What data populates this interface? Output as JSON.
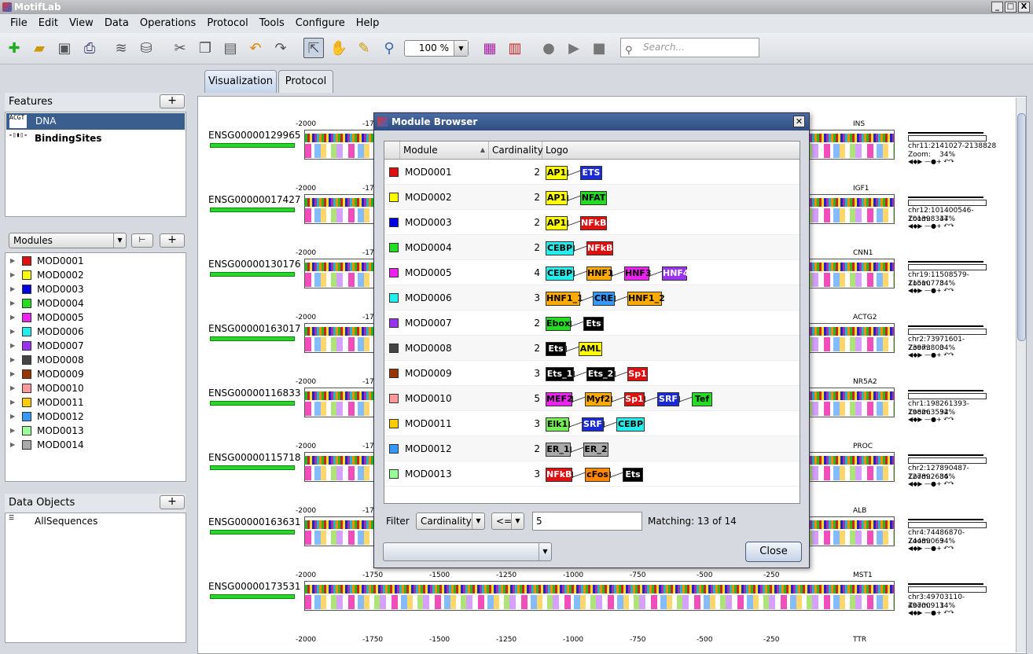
{
  "app": {
    "title": "MotifLab",
    "win_buttons": [
      "_",
      "□",
      "X"
    ]
  },
  "menu": [
    "File",
    "Edit",
    "View",
    "Data",
    "Operations",
    "Protocol",
    "Tools",
    "Configure",
    "Help"
  ],
  "toolbar": {
    "zoom": "100 %",
    "search_placeholder": "Search..."
  },
  "features": {
    "title": "Features",
    "add": "+",
    "items": [
      {
        "label": "DNA",
        "icon": "ACGT"
      },
      {
        "label": "BindingSites"
      }
    ]
  },
  "modules_panel": {
    "combo": "Modules",
    "add": "+",
    "items": [
      {
        "name": "MOD0001",
        "color": "#e01010"
      },
      {
        "name": "MOD0002",
        "color": "#ffff00"
      },
      {
        "name": "MOD0003",
        "color": "#0000e0"
      },
      {
        "name": "MOD0004",
        "color": "#22dd22"
      },
      {
        "name": "MOD0005",
        "color": "#ee22ee"
      },
      {
        "name": "MOD0006",
        "color": "#22eeee"
      },
      {
        "name": "MOD0007",
        "color": "#9933ee"
      },
      {
        "name": "MOD0008",
        "color": "#444444"
      },
      {
        "name": "MOD0009",
        "color": "#993300"
      },
      {
        "name": "MOD0010",
        "color": "#ff9999"
      },
      {
        "name": "MOD0011",
        "color": "#ffcc00"
      },
      {
        "name": "MOD0012",
        "color": "#3399ff"
      },
      {
        "name": "MOD0013",
        "color": "#99ff99"
      },
      {
        "name": "MOD0014",
        "color": "#aaaaaa"
      }
    ]
  },
  "data_objects": {
    "title": "Data Objects",
    "add": "+",
    "items": [
      "AllSequences"
    ]
  },
  "tabs": [
    "Visualization",
    "Protocol"
  ],
  "sequences": [
    {
      "name": "ENSG00000129965",
      "gene": "INS",
      "coord": "chr11:2141027-2138828",
      "zoom": "34%",
      "dir": "left"
    },
    {
      "name": "ENSG00000017427",
      "gene": "IGF1",
      "coord": "chr12:101400546-101398347",
      "zoom": "34%",
      "dir": "left"
    },
    {
      "name": "ENSG00000130176",
      "gene": "CNN1",
      "coord": "chr19:11508579-11510778",
      "zoom": "34%",
      "dir": "right"
    },
    {
      "name": "ENSG00000163017",
      "gene": "ACTG2",
      "coord": "chr2:73971601-73973800",
      "zoom": "34%",
      "dir": "right"
    },
    {
      "name": "ENSG00000116833",
      "gene": "NR5A2",
      "coord": "chr1:198261393-198263592",
      "zoom": "34%",
      "dir": "right"
    },
    {
      "name": "ENSG00000115718",
      "gene": "PROC",
      "coord": "chr2:127890487-127892686",
      "zoom": "34%",
      "dir": "right"
    },
    {
      "name": "ENSG00000163631",
      "gene": "ALB",
      "coord": "chr4:74486870-74489069",
      "zoom": "34%",
      "dir": "right"
    },
    {
      "name": "ENSG00000173531",
      "gene": "MST1",
      "coord": "chr3:49703110-49700911",
      "zoom": "34%",
      "dir": "left"
    },
    {
      "name": "",
      "gene": "TTR",
      "coord": "",
      "zoom": "",
      "dir": "right"
    }
  ],
  "ruler_short": [
    "-2000",
    "-17"
  ],
  "ruler_full": [
    "-2000",
    "-1750",
    "-1500",
    "-1250",
    "-1000",
    "-750",
    "-500",
    "-250"
  ],
  "zoom_label": "Zoom:",
  "dialog": {
    "title": "Module Browser",
    "columns": [
      "Module",
      "Cardinality",
      "Logo"
    ],
    "rows": [
      {
        "name": "MOD0001",
        "color": "#e01010",
        "card": "2",
        "motifs": [
          {
            "t": "AP1",
            "c": "#ffff00",
            "w": 28
          },
          {
            "t": "ETS",
            "c": "#1a2ad8",
            "w": 28,
            "fg": "#fff"
          }
        ]
      },
      {
        "name": "MOD0002",
        "color": "#ffff00",
        "card": "2",
        "motifs": [
          {
            "t": "AP1",
            "c": "#ffff00",
            "w": 28
          },
          {
            "t": "NFAT",
            "c": "#22dd22",
            "w": 34
          }
        ]
      },
      {
        "name": "MOD0003",
        "color": "#0000e0",
        "card": "2",
        "motifs": [
          {
            "t": "AP1",
            "c": "#ffff00",
            "w": 28
          },
          {
            "t": "NFkB",
            "c": "#e01010",
            "w": 34,
            "fg": "#fff"
          }
        ]
      },
      {
        "name": "MOD0004",
        "color": "#22dd22",
        "card": "2",
        "motifs": [
          {
            "t": "CEBP",
            "c": "#22eeee",
            "w": 36
          },
          {
            "t": "NFkB",
            "c": "#e01010",
            "w": 34,
            "fg": "#fff"
          }
        ]
      },
      {
        "name": "MOD0005",
        "color": "#ee22ee",
        "card": "4",
        "motifs": [
          {
            "t": "CEBP",
            "c": "#22eeee",
            "w": 36
          },
          {
            "t": "HNF1",
            "c": "#ffaa00",
            "w": 32
          },
          {
            "t": "HNF3",
            "c": "#ee22ee",
            "w": 32
          },
          {
            "t": "HNF4",
            "c": "#9933ee",
            "w": 32,
            "fg": "#fff"
          }
        ]
      },
      {
        "name": "MOD0006",
        "color": "#22eeee",
        "card": "3",
        "motifs": [
          {
            "t": "HNF1_1",
            "c": "#ffaa00",
            "w": 44
          },
          {
            "t": "CRE",
            "c": "#3399ff",
            "w": 28
          },
          {
            "t": "HNF1_2",
            "c": "#ffaa00",
            "w": 44
          }
        ]
      },
      {
        "name": "MOD0007",
        "color": "#9933ee",
        "card": "2",
        "motifs": [
          {
            "t": "Ebox",
            "c": "#22dd22",
            "w": 32
          },
          {
            "t": "Ets",
            "c": "#000000",
            "w": 26,
            "fg": "#fff"
          }
        ]
      },
      {
        "name": "MOD0008",
        "color": "#444444",
        "card": "2",
        "motifs": [
          {
            "t": "Ets",
            "c": "#000000",
            "w": 26,
            "fg": "#fff"
          },
          {
            "t": "AML",
            "c": "#ffff00",
            "w": 30
          }
        ]
      },
      {
        "name": "MOD0009",
        "color": "#993300",
        "card": "3",
        "motifs": [
          {
            "t": "Ets_1",
            "c": "#000000",
            "w": 36,
            "fg": "#fff"
          },
          {
            "t": "Ets_2",
            "c": "#000000",
            "w": 36,
            "fg": "#fff"
          },
          {
            "t": "Sp1",
            "c": "#e01010",
            "w": 26,
            "fg": "#fff"
          }
        ]
      },
      {
        "name": "MOD0010",
        "color": "#ff9999",
        "card": "5",
        "motifs": [
          {
            "t": "MEF2",
            "c": "#ee22ee",
            "w": 34
          },
          {
            "t": "Myf2",
            "c": "#ffaa00",
            "w": 34
          },
          {
            "t": "Sp1",
            "c": "#e01010",
            "w": 26,
            "fg": "#fff"
          },
          {
            "t": "SRF",
            "c": "#1a2ad8",
            "w": 28,
            "fg": "#fff"
          },
          {
            "t": "Tef",
            "c": "#22dd22",
            "w": 26
          }
        ]
      },
      {
        "name": "MOD0011",
        "color": "#ffcc00",
        "card": "3",
        "motifs": [
          {
            "t": "Elk1",
            "c": "#77ee55",
            "w": 30
          },
          {
            "t": "SRF",
            "c": "#1a2ad8",
            "w": 28,
            "fg": "#fff"
          },
          {
            "t": "CEBP",
            "c": "#22eeee",
            "w": 36
          }
        ]
      },
      {
        "name": "MOD0012",
        "color": "#3399ff",
        "card": "2",
        "motifs": [
          {
            "t": "ER_1",
            "c": "#aaaaaa",
            "w": 32
          },
          {
            "t": "ER_2",
            "c": "#aaaaaa",
            "w": 32
          }
        ]
      },
      {
        "name": "MOD0013",
        "color": "#99ff99",
        "card": "3",
        "motifs": [
          {
            "t": "NFkB",
            "c": "#e01010",
            "w": 34,
            "fg": "#fff"
          },
          {
            "t": "cFos",
            "c": "#ff8800",
            "w": 32
          },
          {
            "t": "Ets",
            "c": "#000000",
            "w": 26,
            "fg": "#fff"
          }
        ]
      }
    ],
    "filter": {
      "label": "Filter",
      "field": "Cardinality",
      "op": "<=",
      "value": "5",
      "matching": "Matching: 13 of 14"
    },
    "close": "Close"
  }
}
